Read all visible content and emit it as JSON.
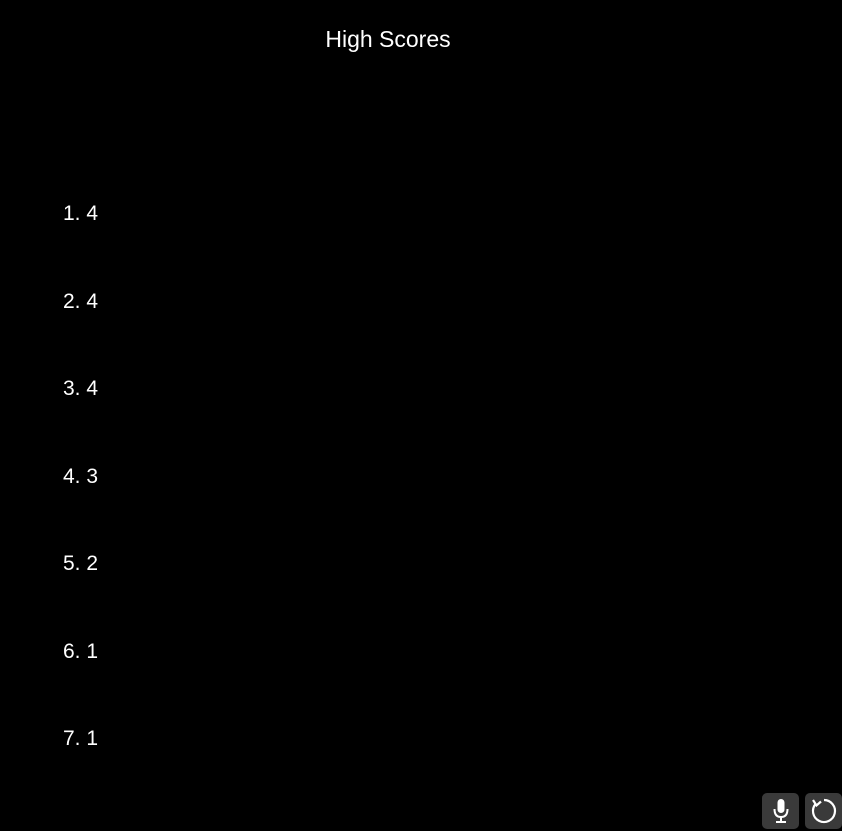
{
  "screen": {
    "title": "High Scores"
  },
  "scores": [
    {
      "rank": "1.",
      "value": "4"
    },
    {
      "rank": "2.",
      "value": "4"
    },
    {
      "rank": "3.",
      "value": "4"
    },
    {
      "rank": "4.",
      "value": "3"
    },
    {
      "rank": "5.",
      "value": "2"
    },
    {
      "rank": "6.",
      "value": "1"
    },
    {
      "rank": "7.",
      "value": "1"
    }
  ],
  "controls": {
    "mic_icon": "microphone-icon",
    "refresh_icon": "refresh-icon"
  },
  "colors": {
    "background": "#000000",
    "text": "#ffffff",
    "button": "#3a3a3a"
  }
}
